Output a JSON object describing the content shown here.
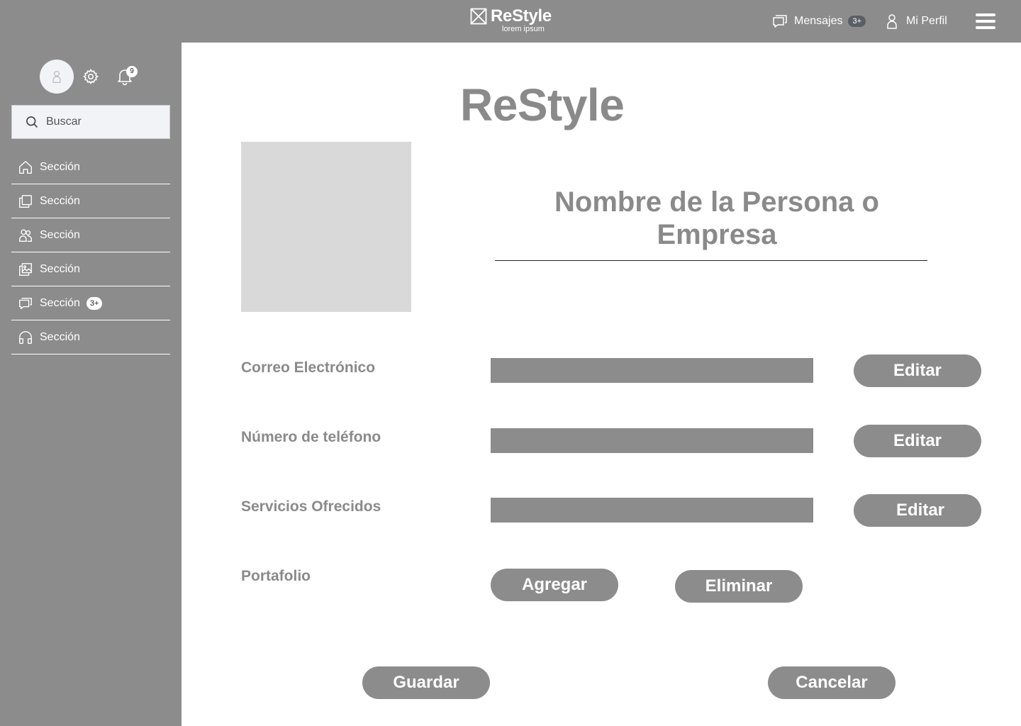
{
  "header": {
    "brand_name": "ReStyle",
    "brand_tagline": "lorem ipsum",
    "messages_label": "Mensajes",
    "messages_badge": "3+",
    "profile_label": "Mi Perfil",
    "icons": {
      "logo": "logo-placeholder-icon",
      "messages": "chat-icon",
      "profile": "user-icon",
      "menu": "hamburger-menu-icon"
    }
  },
  "sidebar": {
    "notifications_badge": "9",
    "search_placeholder": "Buscar",
    "items": [
      {
        "label": "Sección",
        "icon": "home-icon",
        "badge": ""
      },
      {
        "label": "Sección",
        "icon": "copy-icon",
        "badge": ""
      },
      {
        "label": "Sección",
        "icon": "users-icon",
        "badge": ""
      },
      {
        "label": "Sección",
        "icon": "gallery-icon",
        "badge": ""
      },
      {
        "label": "Sección",
        "icon": "chat-icon",
        "badge": "3+"
      },
      {
        "label": "Sección",
        "icon": "headphones-icon",
        "badge": ""
      }
    ]
  },
  "main": {
    "title": "ReStyle",
    "person_name": "Nombre de la Persona o Empresa",
    "fields": [
      {
        "label": "Correo Electrónico",
        "value": "",
        "button": "Editar"
      },
      {
        "label": "Número de teléfono",
        "value": "",
        "button": "Editar"
      },
      {
        "label": "Servicios Ofrecidos",
        "value": "",
        "button": "Editar"
      }
    ],
    "portfolio": {
      "label": "Portafolio",
      "add_button": "Agregar",
      "delete_button": "Eliminar"
    },
    "save_button": "Guardar",
    "cancel_button": "Cancelar"
  },
  "colors": {
    "bar": "#8c8c8c",
    "text_gray": "#8a8a8a",
    "photo_placeholder": "#d9d9d9",
    "search_bg": "#f1f3f7"
  }
}
